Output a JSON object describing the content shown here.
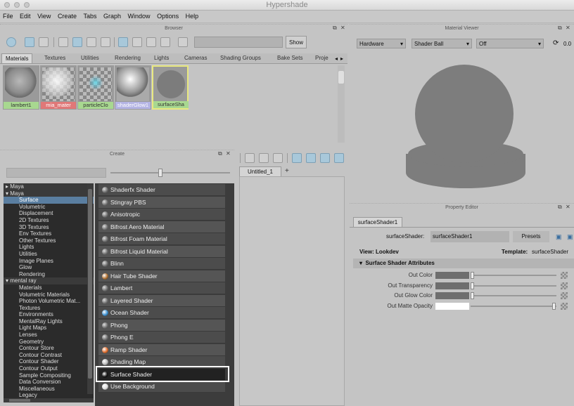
{
  "window": {
    "title": "Hypershade"
  },
  "menu": [
    "File",
    "Edit",
    "View",
    "Create",
    "Tabs",
    "Graph",
    "Window",
    "Options",
    "Help"
  ],
  "browser": {
    "title": "Browser",
    "show_label": "Show",
    "tabs": [
      "Materials",
      "Textures",
      "Utilities",
      "Rendering",
      "Lights",
      "Cameras",
      "Shading Groups",
      "Bake Sets",
      "Proje"
    ],
    "swatches": [
      {
        "label": "lambert1",
        "label_color": "#a8d890"
      },
      {
        "label": "mia_mater",
        "label_color": "#e07878"
      },
      {
        "label": "particleClo",
        "label_color": "#a8d890"
      },
      {
        "label": "shaderGlow1",
        "label_color": "#b4b4e4"
      },
      {
        "label": "surfaceSha",
        "label_color": "#a8d890"
      }
    ]
  },
  "create": {
    "title": "Create",
    "tree": [
      {
        "label": "Maya",
        "kind": "cat-collapsed"
      },
      {
        "label": "Maya",
        "kind": "cat"
      },
      {
        "label": "Surface",
        "kind": "sel"
      },
      {
        "label": "Volumetric",
        "kind": "item"
      },
      {
        "label": "Displacement",
        "kind": "item"
      },
      {
        "label": "2D Textures",
        "kind": "item"
      },
      {
        "label": "3D Textures",
        "kind": "item"
      },
      {
        "label": "Env Textures",
        "kind": "item"
      },
      {
        "label": "Other Textures",
        "kind": "item"
      },
      {
        "label": "Lights",
        "kind": "item"
      },
      {
        "label": "Utilities",
        "kind": "item"
      },
      {
        "label": "Image Planes",
        "kind": "item"
      },
      {
        "label": "Glow",
        "kind": "item"
      },
      {
        "label": "Rendering",
        "kind": "item"
      },
      {
        "label": "mental ray",
        "kind": "cat"
      },
      {
        "label": "Materials",
        "kind": "item"
      },
      {
        "label": "Volumetric Materials",
        "kind": "item"
      },
      {
        "label": "Photon Volumetric Mat...",
        "kind": "item"
      },
      {
        "label": "Textures",
        "kind": "item"
      },
      {
        "label": "Environments",
        "kind": "item"
      },
      {
        "label": "MentalRay Lights",
        "kind": "item"
      },
      {
        "label": "Light Maps",
        "kind": "item"
      },
      {
        "label": "Lenses",
        "kind": "item"
      },
      {
        "label": "Geometry",
        "kind": "item"
      },
      {
        "label": "Contour Store",
        "kind": "item"
      },
      {
        "label": "Contour Contrast",
        "kind": "item"
      },
      {
        "label": "Contour Shader",
        "kind": "item"
      },
      {
        "label": "Contour Output",
        "kind": "item"
      },
      {
        "label": "Sample Compositing",
        "kind": "item"
      },
      {
        "label": "Data Conversion",
        "kind": "item"
      },
      {
        "label": "Miscellaneous",
        "kind": "item"
      },
      {
        "label": "Legacy",
        "kind": "item"
      }
    ],
    "nodes": [
      "Shaderfx Shader",
      "Stingray PBS",
      "Anisotropic",
      "Bifrost Aero Material",
      "Bifrost Foam Material",
      "Bifrost Liquid Material",
      "Blinn",
      "Hair Tube Shader",
      "Lambert",
      "Layered Shader",
      "Ocean Shader",
      "Phong",
      "Phong E",
      "Ramp Shader",
      "Shading Map",
      "Surface Shader",
      "Use Background"
    ],
    "highlighted_node": "Surface Shader"
  },
  "graph": {
    "tab_label": "Untitled_1",
    "add_tab": "+"
  },
  "material_viewer": {
    "title": "Material Viewer",
    "renderer": "Hardware",
    "shape": "Shader Ball",
    "mode": "Off",
    "exposure": "0.0"
  },
  "property_editor": {
    "title": "Property Editor",
    "tab": "surfaceShader1",
    "field_label": "surfaceShader:",
    "field_value": "surfaceShader1",
    "presets_label": "Presets",
    "view_label": "View: Lookdev",
    "template_label": "Template:",
    "template_value": "surfaceShader",
    "section_title": "Surface Shader Attributes",
    "attributes": [
      {
        "label": "Out Color",
        "value": 0.0
      },
      {
        "label": "Out Transparency",
        "value": 0.0
      },
      {
        "label": "Out Glow Color",
        "value": 0.0
      },
      {
        "label": "Out Matte Opacity",
        "value": 1.0
      }
    ]
  }
}
